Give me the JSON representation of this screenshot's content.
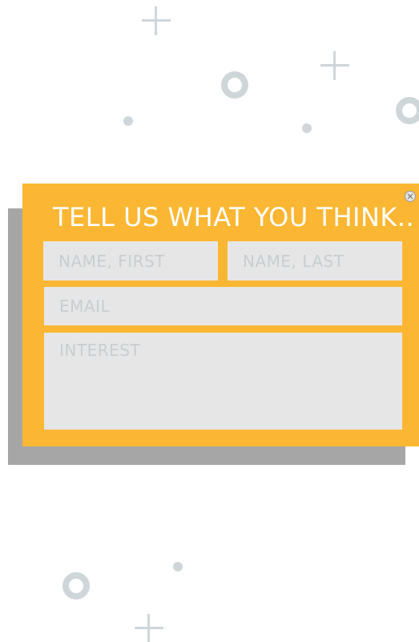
{
  "popup": {
    "title": "TELL US WHAT YOU THINK..",
    "close_icon": "close-icon",
    "fields": {
      "first_name_placeholder": "NAME, FIRST",
      "last_name_placeholder": "NAME, LAST",
      "email_placeholder": "EMAIL",
      "interest_placeholder": "INTEREST"
    }
  },
  "colors": {
    "popup_background": "#fbb733",
    "shadow": "#a6a6a6",
    "field_background": "#e6e6e6",
    "placeholder_text": "#c7ced2",
    "decoration": "#cfd6da"
  },
  "decorations": {
    "icons": [
      "plus-icon",
      "ring-icon",
      "dot-icon"
    ]
  }
}
